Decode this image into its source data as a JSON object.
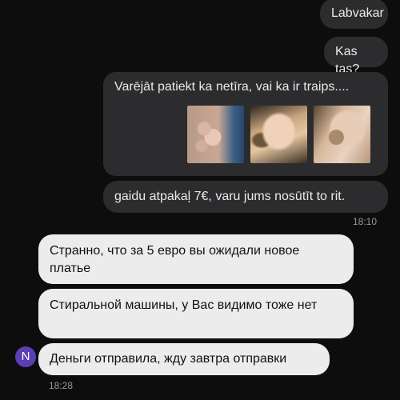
{
  "messages_out": [
    {
      "text": "Labvakar"
    },
    {
      "text": "Kas tas?"
    },
    {
      "text": "Varējāt patiekt ka netīra, vai ka ir traips...."
    },
    {
      "text": "gaidu atpakaļ 7€, varu jums nosūtīt to rit."
    }
  ],
  "time_out": "18:10",
  "messages_in": [
    {
      "text": "Странно, что за 5 евро вы ожидали новое платье"
    },
    {
      "text": "Стиральной машины, у Вас видимо тоже нет"
    },
    {
      "text": "Деньги отправила, жду завтра отправки"
    }
  ],
  "avatar_letter": "N",
  "time_in": "18:28"
}
